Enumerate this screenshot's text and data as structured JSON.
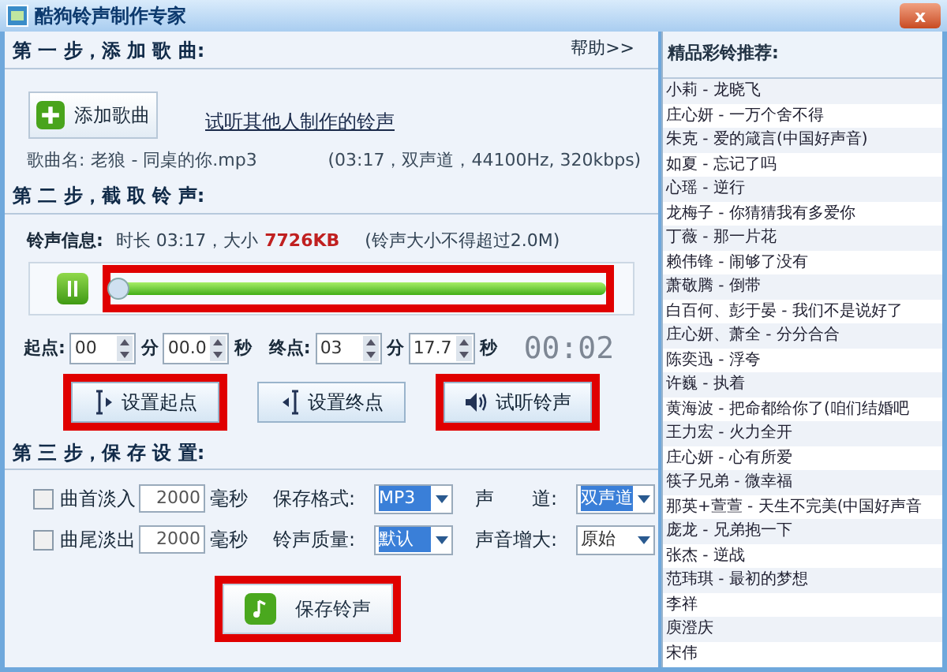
{
  "window": {
    "title": "酷狗铃声制作专家",
    "close": "x"
  },
  "step1": {
    "title": "第 一 步，添 加 歌 曲:",
    "help": "帮助>>",
    "add_button": "添加歌曲",
    "link": "试听其他人制作的铃声",
    "song_label": "歌曲名:",
    "song_name": "老狼 - 同桌的你.mp3",
    "song_info": "(03:17，双声道，44100Hz, 320kbps)"
  },
  "step2": {
    "title": "第 二 步，截 取 铃 声:",
    "info_label": "铃声信息:",
    "info_text": "时长 03:17，大小",
    "size": "7726KB",
    "limit": "(铃声大小不得超过2.0M)",
    "slider": {
      "level": 1,
      "annotated": true
    },
    "fields": [
      {
        "label": "起点:",
        "value": "00",
        "unit": "分"
      },
      {
        "value": "00.0",
        "unit": "秒"
      },
      {
        "label": "终点:",
        "value": "03",
        "unit": "分"
      },
      {
        "value": "17.7",
        "unit": "秒"
      }
    ],
    "timer": "00:02",
    "buttons": [
      {
        "kind": "start",
        "label": "设置起点",
        "annotated": true
      },
      {
        "kind": "end",
        "label": "设置终点",
        "annotated": false
      },
      {
        "kind": "listen",
        "label": "试听铃声",
        "annotated": true
      }
    ]
  },
  "step3": {
    "title": "第 三 步，保 存 设 置:",
    "fades": [
      {
        "label": "曲首淡入",
        "checked": false,
        "value": "2000",
        "unit": "毫秒"
      },
      {
        "label": "曲尾淡出",
        "checked": false,
        "value": "2000",
        "unit": "毫秒"
      }
    ],
    "dropdowns": [
      [
        {
          "label": "保存格式:",
          "value": "MP3",
          "highlighted": true
        },
        {
          "label": "声　　道:",
          "value": "双声道",
          "highlighted": true
        }
      ],
      [
        {
          "label": "铃声质量:",
          "value": "默认",
          "highlighted": true
        },
        {
          "label": "声音增大:",
          "value": "原始",
          "highlighted": false
        }
      ]
    ],
    "save_button": {
      "label": "保存铃声",
      "annotated": true
    }
  },
  "recommend": {
    "title": "精品彩铃推荐:",
    "items": [
      "小莉 - 龙晓飞",
      "庄心妍 - 一万个舍不得",
      "朱克 - 爱的箴言(中国好声音)",
      "如夏 - 忘记了吗",
      "心瑶 - 逆行",
      "龙梅子 - 你猜猜我有多爱你",
      "丁薇 - 那一片花",
      "赖伟锋 - 闹够了没有",
      "萧敬腾 - 倒带",
      "白百何、彭于晏 - 我们不是说好了",
      "庄心妍、萧全 - 分分合合",
      "陈奕迅 - 浮夸",
      "许巍 - 执着",
      "黄海波 - 把命都给你了(咱们结婚吧",
      "王力宏 - 火力全开",
      "庄心妍 - 心有所爱",
      "筷子兄弟 - 微幸福",
      "那英+萱萱 - 天生不完美(中国好声音",
      "庞龙 - 兄弟抱一下",
      "张杰 - 逆战",
      "范玮琪 - 最初的梦想",
      "李祥",
      "庾澄庆",
      "宋伟"
    ]
  }
}
